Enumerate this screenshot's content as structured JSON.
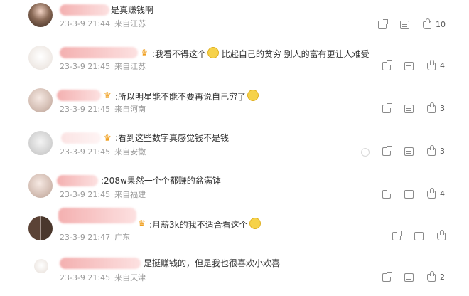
{
  "comments": [
    {
      "text": "是真赚钱啊",
      "date": "23-3-9 21:44",
      "location": "来自江苏",
      "likes": "10"
    },
    {
      "text": ":我看不得这个",
      "text_after": " 比起自己的贫穷 别人的富有更让人难受",
      "date": "23-3-9 21:45",
      "location": "来自江苏",
      "likes": "4"
    },
    {
      "text": ":所以明星能不能不要再说自己穷了",
      "date": "23-3-9 21:45",
      "location": "来自河南",
      "likes": "3"
    },
    {
      "text": ":看到这些数字真感觉钱不是钱",
      "date": "23-3-9 21:45",
      "location": "来自安徽",
      "likes": "3"
    },
    {
      "text": ":208w果然一个个都赚的盆满钵",
      "date": "23-3-9 21:45",
      "location": "来自福建",
      "likes": "4"
    },
    {
      "text": ":月薪3k的我不适合看这个",
      "date": "23-3-9 21:47",
      "location": "广东",
      "likes": ""
    },
    {
      "text": "是挺赚钱的，但是我也很喜欢小欢喜",
      "date": "23-3-9 21:45",
      "location": "来自天津",
      "likes": "2"
    }
  ],
  "icons": {
    "share": "share-icon",
    "comment": "comment-icon",
    "like": "thumbs-up-icon",
    "vip": "crown-icon"
  },
  "colors": {
    "meta": "#999999",
    "icon": "#8a8a8a",
    "text": "#333333",
    "vip": "#f0a020"
  }
}
